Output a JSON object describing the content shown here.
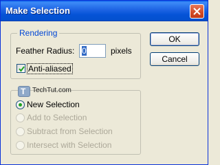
{
  "window": {
    "title": "Make Selection"
  },
  "rendering": {
    "legend": "Rendering",
    "feather_label": "Feather Radius:",
    "feather_value": "0",
    "feather_unit": "pixels",
    "antialias_label": "Anti-aliased",
    "antialias_checked": true
  },
  "operation": {
    "logo_text": "TechTut.com",
    "logo_mark": "T",
    "options": [
      {
        "label": "New Selection",
        "selected": true,
        "enabled": true
      },
      {
        "label": "Add to Selection",
        "selected": false,
        "enabled": false
      },
      {
        "label": "Subtract from Selection",
        "selected": false,
        "enabled": false
      },
      {
        "label": "Intersect with Selection",
        "selected": false,
        "enabled": false
      }
    ]
  },
  "buttons": {
    "ok": "OK",
    "cancel": "Cancel"
  }
}
